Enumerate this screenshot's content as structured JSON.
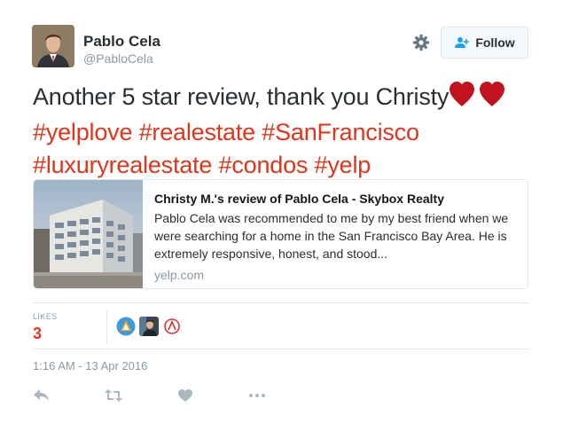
{
  "user": {
    "name": "Pablo Cela",
    "handle": "@PabloCela"
  },
  "follow_label": "Follow",
  "tweet": {
    "text_lead": "Another 5 star review, thank you Christy",
    "hashtags": [
      "#yelplove",
      "#realestate",
      "#SanFrancisco",
      "#luxuryrealestate",
      "#condos",
      "#yelp"
    ]
  },
  "card": {
    "title": "Christy M.'s review of Pablo Cela - Skybox Realty",
    "description": "Pablo Cela was recommended to me by my best friend when we were searching for a home in the San Francisco Bay Area. He is extremely responsive, honest, and stood...",
    "domain": "yelp.com"
  },
  "stats": {
    "likes_label": "LIKES",
    "likes_count": "3"
  },
  "timestamp": "1:16 AM - 13 Apr 2016",
  "icons": {
    "settings": "gear-icon",
    "follow": "add-user-icon",
    "reply": "reply-icon",
    "retweet": "retweet-icon",
    "like": "heart-icon",
    "more": "more-icon"
  },
  "colors": {
    "accent": "#e0351b",
    "muted": "#8899a6",
    "text": "#292f33",
    "heart": "#c1121f"
  }
}
